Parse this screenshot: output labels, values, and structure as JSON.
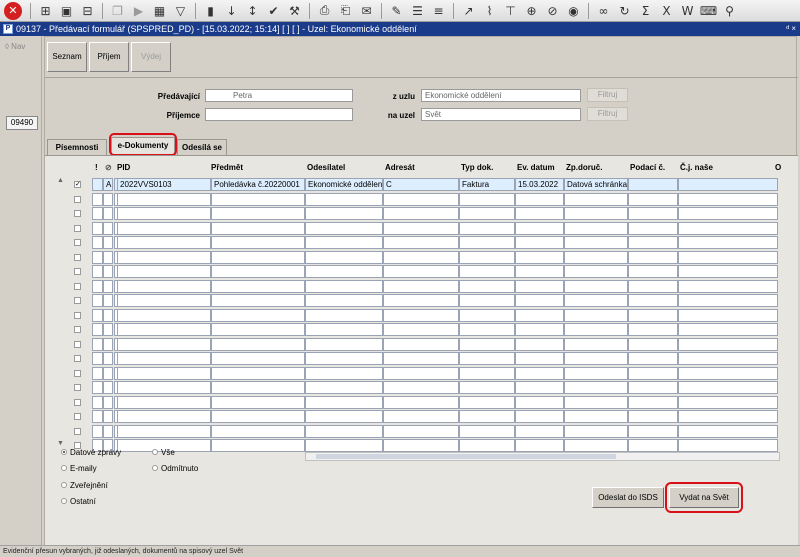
{
  "toolbar": {
    "icons": [
      "close-icon",
      "add-icon",
      "save-icon",
      "delete-icon",
      "copy-icon",
      "run-icon",
      "calendar-icon",
      "filter-icon",
      "chart-icon",
      "sort-icon",
      "sort-desc-icon",
      "check-icon",
      "wrench-icon",
      "print-icon",
      "print-preview-icon",
      "mail-icon",
      "edit-icon",
      "list-icon",
      "numbered-list-icon",
      "export-icon",
      "attach-icon",
      "split-icon",
      "globe-icon",
      "no-icon",
      "eye-icon",
      "glasses-icon",
      "refresh-icon",
      "sum-icon",
      "excel-icon",
      "word-icon",
      "keyboard-icon",
      "tree-icon"
    ]
  },
  "window": {
    "title": "09137 - Předávací formulář (SPSPRED_PD) - [15.03.2022; 15:14]  [ ] [ ] - Uzel: Ekonomické oddělení",
    "controls": "ᵈ ×"
  },
  "leftstrip": {
    "nav": "◊ Nav",
    "record_no": "09490"
  },
  "top_buttons": {
    "seznam": "Seznam",
    "prijem": "Příjem",
    "vydej": "Výdej"
  },
  "form": {
    "predavajici_label": "Předávající",
    "predavajici_value": "Petra",
    "prijemce_label": "Příjemce",
    "prijemce_value": "",
    "z_uzlu_label": "z uzlu",
    "z_uzlu_value": "Ekonomické oddělení",
    "na_uzel_label": "na uzel",
    "na_uzel_value": "Svět",
    "filtruj": "Filtruj"
  },
  "tabs": [
    {
      "label": "Písemnosti"
    },
    {
      "label": "e-Dokumenty"
    },
    {
      "label": "Odesílá se"
    }
  ],
  "grid": {
    "headers": {
      "flag": "!",
      "attach": "📎",
      "pid": "PID",
      "predmet": "Předmět",
      "odesilatel": "Odesílatel",
      "adresat": "Adresát",
      "typ": "Typ dok.",
      "ev_datum": "Ev. datum",
      "zp_doruc": "Zp.doruč.",
      "podaci": "Podací č.",
      "cj": "Č.j. naše",
      "extra": "O"
    },
    "first_row": {
      "checked": "✓",
      "flag": "A",
      "pid": "2022VVS0103",
      "predmet": "Pohledávka č.20220001",
      "odesilatel": "Ekonomické oddělen",
      "adresat": "C",
      "typ": "Faktura",
      "ev_datum": "15.03.2022",
      "zp_doruc": "Datová schránka",
      "podaci": "",
      "cj": ""
    }
  },
  "filters": {
    "left": [
      "Datové zprávy",
      "E-maily",
      "Zveřejnění",
      "Ostatní"
    ],
    "right": [
      "Vše",
      "Odmítnuto"
    ],
    "selected": "Datové zprávy"
  },
  "actions": {
    "odeslat": "Odeslat do ISDS",
    "vydat": "Vydat na Svět"
  },
  "status": "Evidenční přesun vybraných, již odeslaných, dokumentů na spisový uzel Svět",
  "colors": {
    "titlebar": "#1a3a8a",
    "highlight": "#d8101a",
    "close": "#d42020"
  }
}
